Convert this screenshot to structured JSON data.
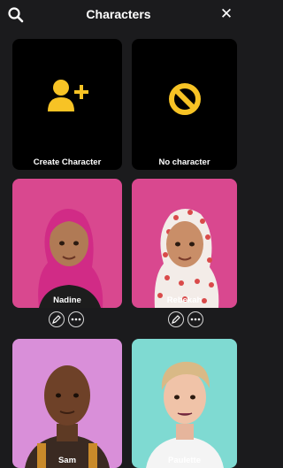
{
  "header": {
    "title": "Characters",
    "search_icon": "search-icon",
    "close_icon": "close-icon"
  },
  "accent_color": "#f7c325",
  "cards": [
    {
      "name": "create-character",
      "label": "Create Character",
      "icon": "add-person-icon",
      "bg": "#000000"
    },
    {
      "name": "no-character",
      "label": "No character",
      "icon": "prohibited-icon",
      "bg": "#000000"
    },
    {
      "name": "nadine",
      "label": "Nadine",
      "bg": "#d9488f"
    },
    {
      "name": "rebekah",
      "label": "Rebekah",
      "bg": "#d9488f"
    },
    {
      "name": "sam",
      "label": "Sam",
      "bg": "#d98fd9"
    },
    {
      "name": "paulette",
      "label": "Paulette",
      "bg": "#7fdad2"
    }
  ],
  "card_actions": {
    "edit_icon": "edit-pencil-icon",
    "more_icon": "more-options-icon"
  }
}
